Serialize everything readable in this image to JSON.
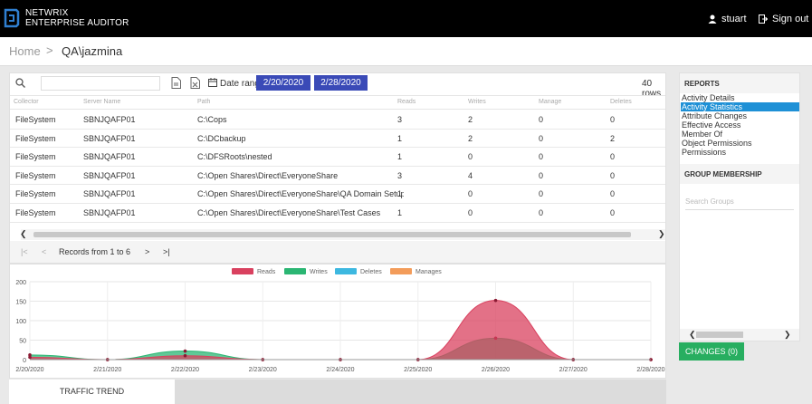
{
  "header": {
    "brand_line1": "NETWRIX",
    "brand_line2": "ENTERPRISE AUDITOR",
    "user_name": "stuart",
    "signout_label": "Sign out"
  },
  "breadcrumb": {
    "home": "Home",
    "separator": ">",
    "current": "QA\\jazmina"
  },
  "toolbar": {
    "search_placeholder": "",
    "date_range_label": "Date range:",
    "start_date": "2/20/2020",
    "end_date": "2/28/2020",
    "rows_count": "40 rows"
  },
  "grid": {
    "columns": [
      "Collector",
      "Server Name",
      "Path",
      "Reads",
      "Writes",
      "Manage",
      "Deletes"
    ],
    "rows": [
      [
        "FileSystem",
        "SBNJQAFP01",
        "C:\\Cops",
        "3",
        "2",
        "0",
        "0"
      ],
      [
        "FileSystem",
        "SBNJQAFP01",
        "C:\\DCbackup",
        "1",
        "2",
        "0",
        "2"
      ],
      [
        "FileSystem",
        "SBNJQAFP01",
        "C:\\DFSRoots\\nested",
        "1",
        "0",
        "0",
        "0"
      ],
      [
        "FileSystem",
        "SBNJQAFP01",
        "C:\\Open Shares\\Direct\\EveryoneShare",
        "3",
        "4",
        "0",
        "0"
      ],
      [
        "FileSystem",
        "SBNJQAFP01",
        "C:\\Open Shares\\Direct\\EveryoneShare\\QA Domain Setup",
        "1",
        "0",
        "0",
        "0"
      ],
      [
        "FileSystem",
        "SBNJQAFP01",
        "C:\\Open Shares\\Direct\\EveryoneShare\\Test Cases",
        "1",
        "0",
        "0",
        "0"
      ]
    ]
  },
  "pager": {
    "first": "|<",
    "prev": "<",
    "label": "Records from 1 to 6",
    "next": ">",
    "last": ">|"
  },
  "chart_data": {
    "type": "area",
    "x": [
      "2/20/2020",
      "2/21/2020",
      "2/22/2020",
      "2/23/2020",
      "2/24/2020",
      "2/25/2020",
      "2/26/2020",
      "2/27/2020",
      "2/28/2020"
    ],
    "series": [
      {
        "name": "Reads",
        "color": "#d9415f",
        "values": [
          6,
          0,
          10,
          0,
          0,
          0,
          152,
          0,
          0
        ]
      },
      {
        "name": "Writes",
        "color": "#2bb673",
        "values": [
          12,
          0,
          22,
          0,
          0,
          0,
          55,
          0,
          0
        ]
      },
      {
        "name": "Deletes",
        "color": "#3db8e0",
        "values": [
          0,
          0,
          0,
          0,
          0,
          0,
          0,
          0,
          0
        ]
      },
      {
        "name": "Manages",
        "color": "#f39c5a",
        "values": [
          0,
          0,
          0,
          0,
          0,
          0,
          0,
          0,
          0
        ]
      }
    ],
    "yticks": [
      "200",
      "150",
      "100",
      "50",
      "0"
    ],
    "ylim": [
      0,
      200
    ],
    "grid": true,
    "legend": "top-center"
  },
  "tabs": {
    "active": "TRAFFIC TREND"
  },
  "sidebar": {
    "reports_title": "REPORTS",
    "reports": [
      "Activity Details",
      "Activity Statistics",
      "Attribute Changes",
      "Effective Access",
      "Member Of",
      "Object Permissions",
      "Permissions"
    ],
    "active_report": 1,
    "group_title": "GROUP MEMBERSHIP",
    "group_search_placeholder": "Search Groups",
    "changes_button": "CHANGES (0)"
  },
  "colors": {
    "accent": "#3a4ab7",
    "selection": "#1e90d6",
    "success": "#27ae60"
  }
}
